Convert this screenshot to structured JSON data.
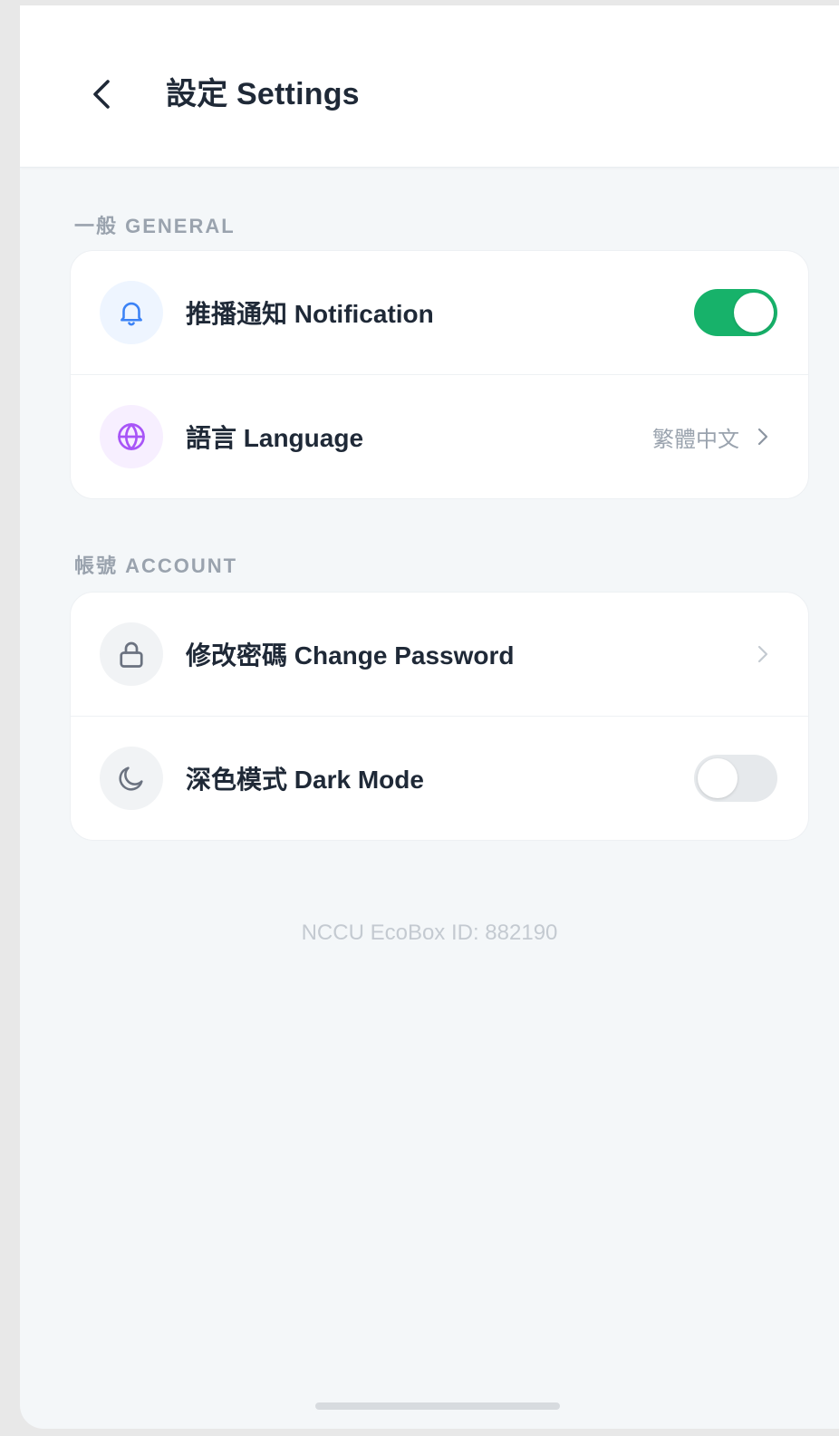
{
  "header": {
    "title": "設定 Settings",
    "back_icon": "chevron-left-icon"
  },
  "sections": [
    {
      "label": "一般 GENERAL",
      "items": [
        {
          "icon": "bell-icon",
          "label": "推播通知 Notification",
          "control": "toggle",
          "enabled": true
        },
        {
          "icon": "globe-icon",
          "label": "語言 Language",
          "control": "link",
          "value": "繁體中文"
        }
      ]
    },
    {
      "label": "帳號 ACCOUNT",
      "items": [
        {
          "icon": "lock-icon",
          "label": "修改密碼 Change Password",
          "control": "link"
        },
        {
          "icon": "moon-icon",
          "label": "深色模式 Dark Mode",
          "control": "toggle",
          "enabled": false
        }
      ]
    }
  ],
  "footer": {
    "id_text": "NCCU EcoBox ID: 882190"
  },
  "colors": {
    "accent_green": "#17b26a",
    "bell_blue": "#3b82f6",
    "globe_purple": "#a855f7",
    "text_dark": "#1f2937",
    "text_muted": "#9aa3ae"
  }
}
